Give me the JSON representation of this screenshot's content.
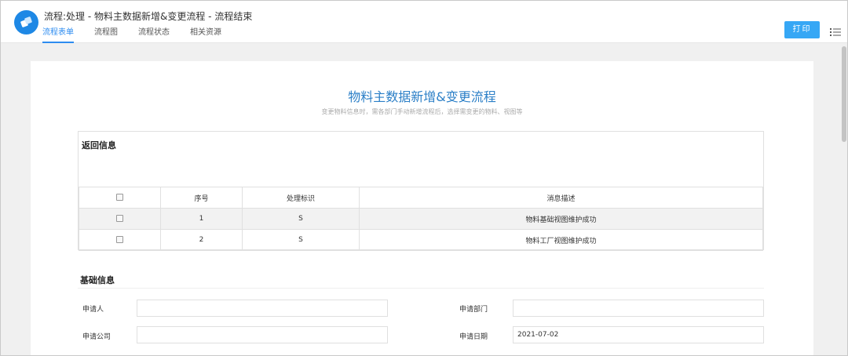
{
  "app": {
    "title": "流程:处理 - 物料主数据新增&变更流程 - 流程结束"
  },
  "tabs": [
    {
      "label": "流程表单",
      "active": true
    },
    {
      "label": "流程图",
      "active": false
    },
    {
      "label": "流程状态",
      "active": false
    },
    {
      "label": "相关资源",
      "active": false
    }
  ],
  "toolbar": {
    "print_label": "打印",
    "menu_icon": "list-icon"
  },
  "colors": {
    "accent": "#2d8cf0",
    "title_blue": "#2b7fc7",
    "print_button": "#36a7f5",
    "logo": "#1e88e5"
  },
  "form": {
    "title": "物料主数据新增&变更流程",
    "subtitle": "变更物料信息时，需各部门手动新增流程后，选择需变更的物料、视图等"
  },
  "return_info": {
    "section_title": "返回信息",
    "columns": [
      "序号",
      "处理标识",
      "消息描述"
    ],
    "rows": [
      {
        "no": "1",
        "flag": "S",
        "message": "物料基础视图维护成功"
      },
      {
        "no": "2",
        "flag": "S",
        "message": "物料工厂视图维护成功"
      }
    ]
  },
  "basic_info": {
    "section_title": "基础信息",
    "fields": {
      "applicant": {
        "label": "申请人",
        "value": ""
      },
      "department": {
        "label": "申请部门",
        "value": ""
      },
      "company": {
        "label": "申请公司",
        "value": ""
      },
      "date": {
        "label": "申请日期",
        "value": "2021-07-02"
      }
    }
  }
}
